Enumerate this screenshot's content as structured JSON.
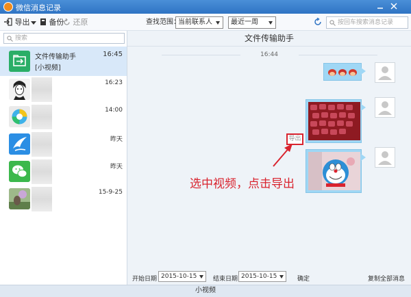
{
  "window": {
    "title": "微信消息记录"
  },
  "toolbar": {
    "export_label": "导出",
    "backup_label": "备份",
    "restore_label": "还原",
    "find_range_label": "查找范围：",
    "contact_filter": "当前联系人",
    "period_filter": "最近一周",
    "search_placeholder": "按回车搜索消息记录"
  },
  "sidebar": {
    "search_placeholder": "搜索",
    "contacts": [
      {
        "name": "文件传输助手",
        "time": "16:45",
        "preview": "[小视频]"
      },
      {
        "time": "16:23"
      },
      {
        "time": "14:00"
      },
      {
        "time": "昨天"
      },
      {
        "time": "昨天"
      },
      {
        "time": "15-9-25"
      }
    ]
  },
  "chat": {
    "title": "文件传输助手",
    "time_separator": "16:44",
    "export_button": "导出",
    "annotation": "选中视频，点击导出"
  },
  "footer": {
    "start_label": "开始日期",
    "start_date": "2015-10-15",
    "end_label": "结束日期",
    "end_date": "2015-10-15",
    "confirm": "确定",
    "copy_all": "复制全部消息"
  },
  "status": {
    "text": "小视频"
  },
  "colors": {
    "titlebar": "#2f74c4",
    "selected_row": "#d8e8f9",
    "bubble": "#9fd7f5",
    "annotation": "#d9232e"
  }
}
